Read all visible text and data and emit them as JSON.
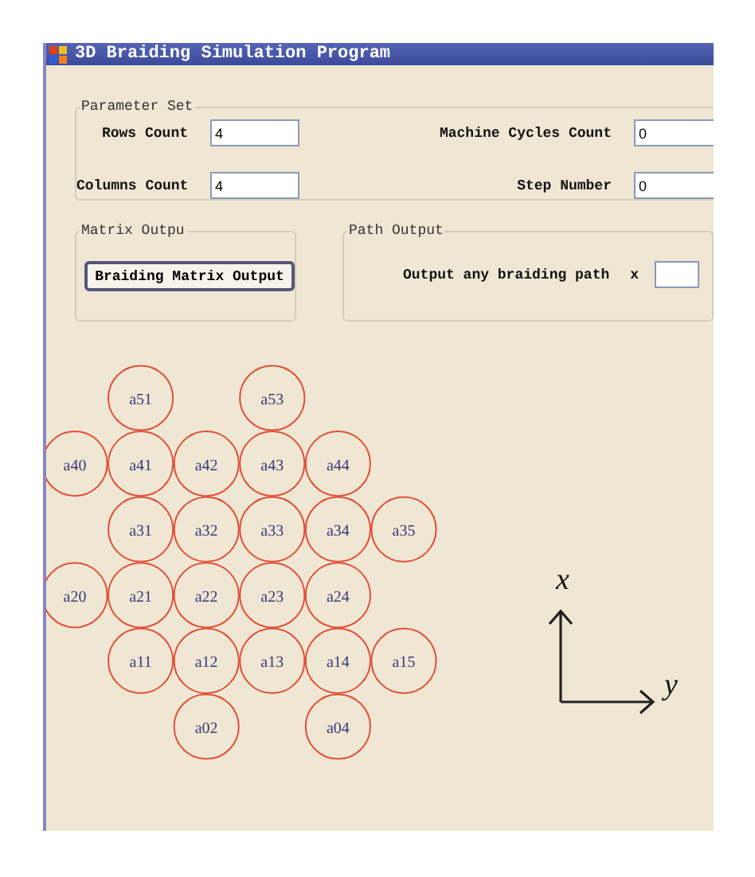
{
  "window": {
    "title": "3D Braiding Simulation Program"
  },
  "parameter_set": {
    "title": "Parameter Set",
    "fields": [
      {
        "label": "Rows Count",
        "value": "4"
      },
      {
        "label": "Machine Cycles Count",
        "value": "0"
      },
      {
        "label": "Columns Count",
        "value": "4"
      },
      {
        "label": "Step Number",
        "value": "0"
      }
    ]
  },
  "matrix_output": {
    "title": "Matrix Outpu",
    "button": "Braiding Matrix Output"
  },
  "path_output": {
    "title": "Path Output",
    "label": "Output any braiding path",
    "x_label": "x"
  },
  "carriers": [
    [
      {
        "kind": "gap"
      },
      {
        "kind": "carrier",
        "label": "a51"
      },
      {
        "kind": "gap"
      },
      {
        "kind": "carrier",
        "label": "a53"
      }
    ],
    [
      {
        "kind": "carrier",
        "label": "a40"
      },
      {
        "kind": "carrier",
        "label": "a41"
      },
      {
        "kind": "carrier",
        "label": "a42"
      },
      {
        "kind": "carrier",
        "label": "a43"
      },
      {
        "kind": "carrier",
        "label": "a44"
      }
    ],
    [
      {
        "kind": "gap"
      },
      {
        "kind": "carrier",
        "label": "a31"
      },
      {
        "kind": "carrier",
        "label": "a32"
      },
      {
        "kind": "carrier",
        "label": "a33"
      },
      {
        "kind": "carrier",
        "label": "a34"
      },
      {
        "kind": "carrier",
        "label": "a35"
      }
    ],
    [
      {
        "kind": "carrier",
        "label": "a20"
      },
      {
        "kind": "carrier",
        "label": "a21"
      },
      {
        "kind": "carrier",
        "label": "a22"
      },
      {
        "kind": "carrier",
        "label": "a23"
      },
      {
        "kind": "carrier",
        "label": "a24"
      }
    ],
    [
      {
        "kind": "gap"
      },
      {
        "kind": "carrier",
        "label": "a11"
      },
      {
        "kind": "carrier",
        "label": "a12"
      },
      {
        "kind": "carrier",
        "label": "a13"
      },
      {
        "kind": "carrier",
        "label": "a14"
      },
      {
        "kind": "carrier",
        "label": "a15"
      }
    ],
    [
      {
        "kind": "gap"
      },
      {
        "kind": "gap"
      },
      {
        "kind": "carrier",
        "label": "a02"
      },
      {
        "kind": "gap"
      },
      {
        "kind": "carrier",
        "label": "a04"
      }
    ]
  ],
  "axes": {
    "vertical": "x",
    "horizontal": "y"
  }
}
